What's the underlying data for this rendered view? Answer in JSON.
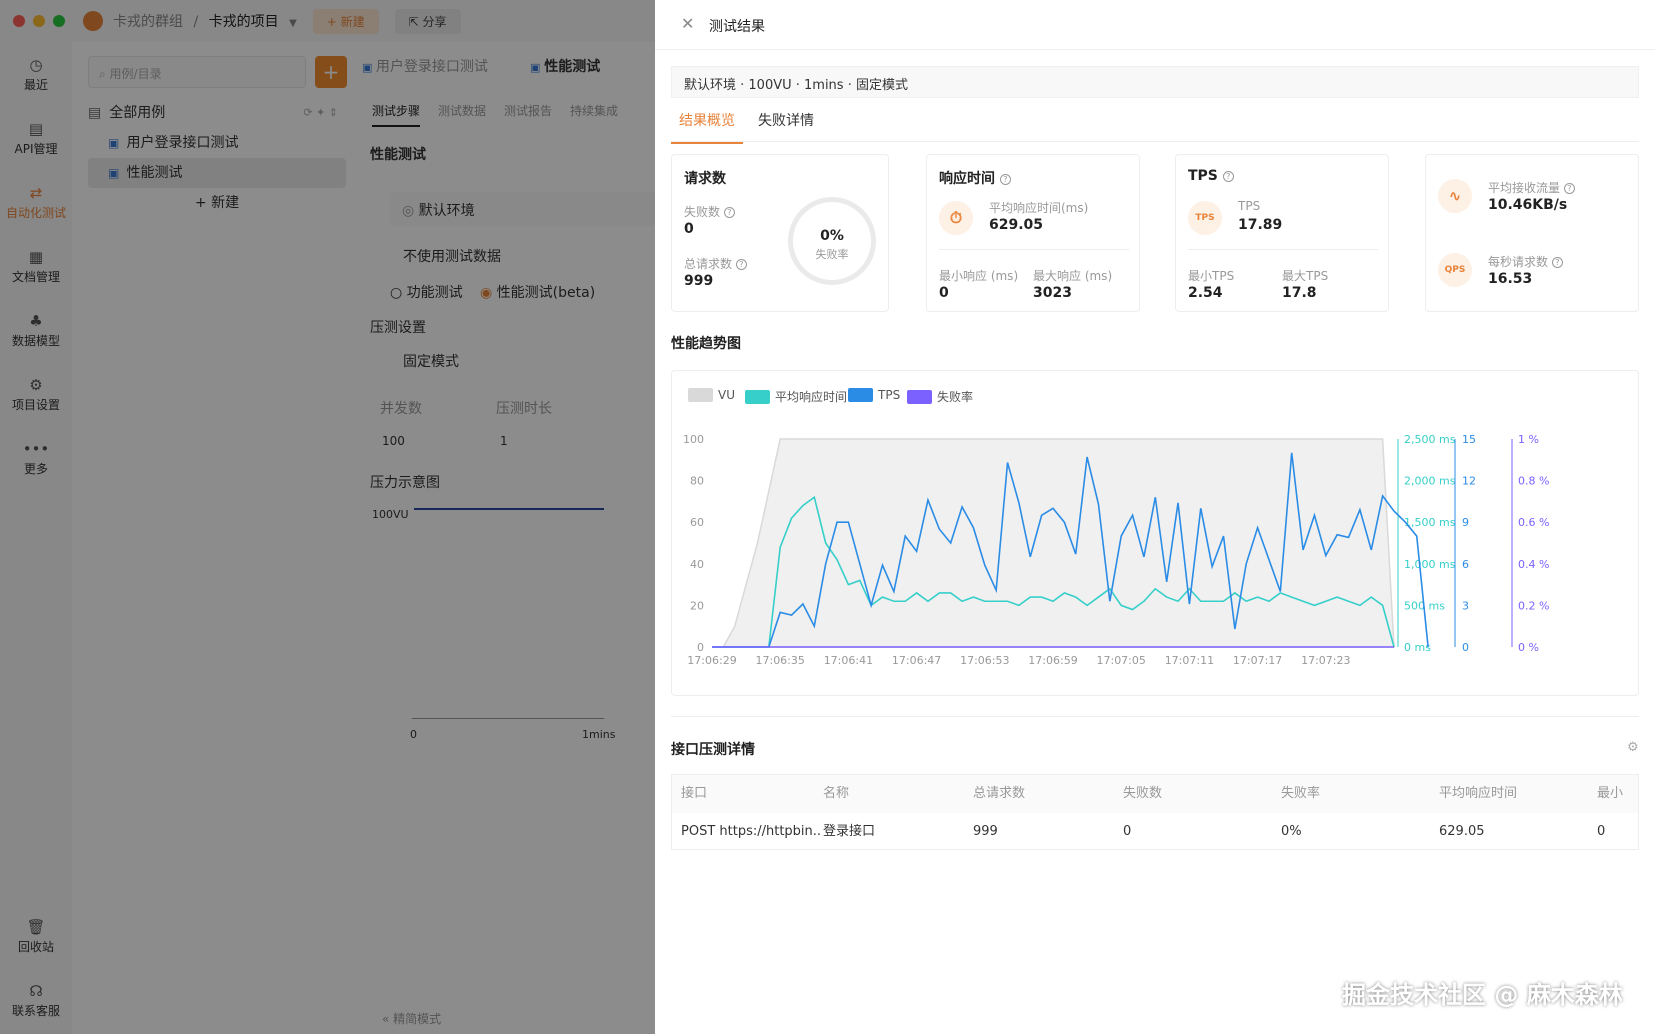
{
  "titlebar": {
    "group": "卡戎的群组",
    "separator": "/",
    "project": "卡戎的项目",
    "new_label": "+ 新建",
    "share_label": "分享"
  },
  "sidenav": {
    "items": [
      {
        "label": "最近",
        "icon": "clock-icon"
      },
      {
        "label": "API管理",
        "icon": "api-icon"
      },
      {
        "label": "自动化测试",
        "icon": "automation-icon"
      },
      {
        "label": "文档管理",
        "icon": "document-icon"
      },
      {
        "label": "数据模型",
        "icon": "data-model-icon"
      },
      {
        "label": "项目设置",
        "icon": "settings-icon"
      },
      {
        "label": "更多",
        "icon": "more-icon"
      }
    ],
    "bottom": [
      {
        "label": "回收站",
        "icon": "trash-icon"
      },
      {
        "label": "联系客服",
        "icon": "headset-icon"
      }
    ]
  },
  "tree": {
    "search_placeholder": "用例/目录",
    "root": "全部用例",
    "items": [
      "用户登录接口测试",
      "性能测试"
    ],
    "new_label": "+ 新建"
  },
  "main": {
    "tabs": [
      "用户登录接口测试",
      "性能测试"
    ],
    "subtabs": [
      "测试步骤",
      "测试数据",
      "测试报告",
      "持续集成"
    ],
    "heading": "性能测试",
    "env": "默认环境",
    "data_select": "不使用测试数据",
    "radio_functional": "功能测试",
    "radio_perf": "性能测试(beta)",
    "pressure_settings": "压测设置",
    "mode": "固定模式",
    "col_concurrency": "并发数",
    "col_duration": "压测时长",
    "concurrency": "100",
    "duration": "1",
    "diagram_title": "压力示意图",
    "diagram_vu": "100VU",
    "diagram_x0": "0",
    "diagram_x1": "1mins",
    "footer": "精简模式"
  },
  "drawer": {
    "title": "测试结果",
    "env_summary": "默认环境 · 100VU · 1mins · 固定模式",
    "tabs": [
      "结果概览",
      "失败详情"
    ],
    "requests": {
      "title": "请求数",
      "failed_label": "失败数",
      "failed": "0",
      "total_label": "总请求数",
      "total": "999",
      "fail_rate": "0%",
      "fail_rate_label": "失败率"
    },
    "response": {
      "title": "响应时间",
      "avg_label": "平均响应时间(ms)",
      "avg": "629.05",
      "min_label": "最小响应 (ms)",
      "min": "0",
      "max_label": "最大响应 (ms)",
      "max": "3023"
    },
    "tps": {
      "title": "TPS",
      "badge": "TPS",
      "label": "TPS",
      "value": "17.89",
      "min_label": "最小TPS",
      "min": "2.54",
      "max_label": "最大TPS",
      "max": "17.8"
    },
    "throughput": {
      "recv_label": "平均接收流量",
      "recv": "10.46KB/s",
      "qps_badge": "QPS",
      "qps_label": "每秒请求数",
      "qps": "16.53"
    },
    "chart_title": "性能趋势图",
    "details_title": "接口压测详情",
    "table": {
      "headers": [
        "接口",
        "名称",
        "总请求数",
        "失败数",
        "失败率",
        "平均响应时间",
        "最小"
      ],
      "rows": [
        [
          "POST https://httpbin...",
          "登录接口",
          "999",
          "0",
          "0%",
          "629.05",
          "0"
        ]
      ]
    }
  },
  "watermark": "掘金技术社区 @ 麻木森林",
  "colors": {
    "accent": "#e8833a",
    "vu": "#d9d9d9",
    "avg": "#36cfc9",
    "tps": "#2b8ce6",
    "fail": "#7b61ff"
  },
  "chart_data": {
    "type": "line",
    "x": [
      "17:06:29",
      "17:06:35",
      "17:06:41",
      "17:06:47",
      "17:06:53",
      "17:06:59",
      "17:07:05",
      "17:07:11",
      "17:07:17",
      "17:07:23"
    ],
    "x_index_range": [
      0,
      60
    ],
    "axes": [
      {
        "id": "vu",
        "ticks": [
          "0",
          "20",
          "40",
          "60",
          "80",
          "100"
        ],
        "range": [
          0,
          100
        ]
      },
      {
        "id": "ms",
        "ticks": [
          "0 ms",
          "500 ms",
          "1,000 ms",
          "1,500 ms",
          "2,000 ms",
          "2,500 ms"
        ],
        "range": [
          0,
          2500
        ]
      },
      {
        "id": "tps",
        "ticks": [
          "0",
          "3",
          "6",
          "9",
          "12",
          "15"
        ],
        "range": [
          0,
          15
        ]
      },
      {
        "id": "pct",
        "ticks": [
          "0 %",
          "0.2 %",
          "0.4 %",
          "0.6 %",
          "0.8 %",
          "1 %"
        ],
        "range": [
          0,
          1
        ]
      }
    ],
    "series": [
      {
        "name": "VU",
        "axis": "vu",
        "values": [
          0,
          0,
          10,
          30,
          50,
          75,
          100,
          100,
          100,
          100,
          100,
          100,
          100,
          100,
          100,
          100,
          100,
          100,
          100,
          100,
          100,
          100,
          100,
          100,
          100,
          100,
          100,
          100,
          100,
          100,
          100,
          100,
          100,
          100,
          100,
          100,
          100,
          100,
          100,
          100,
          100,
          100,
          100,
          100,
          100,
          100,
          100,
          100,
          100,
          100,
          100,
          100,
          100,
          100,
          100,
          100,
          100,
          100,
          100,
          100,
          0
        ]
      },
      {
        "name": "平均响应时间",
        "axis": "ms",
        "values": [
          0,
          0,
          0,
          0,
          0,
          0,
          1200,
          1550,
          1700,
          1800,
          1250,
          1050,
          750,
          800,
          500,
          600,
          550,
          550,
          650,
          550,
          650,
          650,
          550,
          600,
          550,
          550,
          550,
          500,
          600,
          600,
          550,
          650,
          600,
          500,
          600,
          700,
          500,
          450,
          550,
          700,
          600,
          550,
          700,
          550,
          550,
          550,
          650,
          550,
          600,
          550,
          650,
          600,
          550,
          500,
          550,
          600,
          550,
          500,
          600,
          500,
          0
        ]
      },
      {
        "name": "TPS",
        "axis": "tps",
        "values": [
          0,
          0,
          0,
          0,
          0,
          0,
          2.5,
          2.3,
          3.1,
          1.5,
          6,
          9,
          9,
          6,
          3,
          5.9,
          4,
          8,
          6.9,
          10.6,
          8.5,
          7.5,
          10.1,
          8.6,
          5.9,
          4.1,
          13.3,
          10.4,
          6.5,
          9.5,
          10,
          9,
          6.7,
          13.7,
          10.3,
          3.3,
          8,
          9.5,
          6.5,
          10.8,
          4.7,
          10.4,
          3.1,
          10,
          5.8,
          8,
          1.3,
          6,
          8.6,
          6.3,
          4,
          14,
          7,
          9.5,
          6.6,
          8.1,
          7.9,
          9.9,
          7,
          10.9,
          9.8,
          9,
          8,
          0
        ]
      },
      {
        "name": "失败率",
        "axis": "pct",
        "values": [
          0,
          0,
          0,
          0,
          0,
          0,
          0,
          0,
          0,
          0,
          0,
          0,
          0,
          0,
          0,
          0,
          0,
          0,
          0,
          0,
          0,
          0,
          0,
          0,
          0,
          0,
          0,
          0,
          0,
          0,
          0,
          0,
          0,
          0,
          0,
          0,
          0,
          0,
          0,
          0,
          0,
          0,
          0,
          0,
          0,
          0,
          0,
          0,
          0,
          0,
          0,
          0,
          0,
          0,
          0,
          0,
          0,
          0,
          0,
          0,
          0
        ]
      }
    ]
  }
}
